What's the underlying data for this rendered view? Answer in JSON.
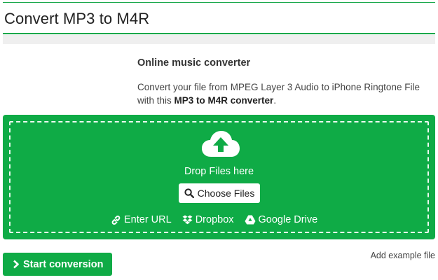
{
  "header": {
    "title": "Convert MP3 to M4R"
  },
  "intro": {
    "heading": "Online music converter",
    "text_before": "Convert your file from MPEG Layer 3 Audio to iPhone Ringtone File with this ",
    "text_bold": "MP3 to M4R converter",
    "text_after": "."
  },
  "upload": {
    "cloud_icon": "cloud-upload-icon",
    "drop_label": "Drop Files here",
    "choose_label": "Choose Files",
    "sources": [
      {
        "label": "Enter URL",
        "icon": "link-icon"
      },
      {
        "label": "Dropbox",
        "icon": "dropbox-icon"
      },
      {
        "label": "Google Drive",
        "icon": "google-drive-icon"
      }
    ]
  },
  "actions": {
    "start_label": "Start conversion",
    "example_label": "Add example file"
  },
  "colors": {
    "accent": "#0fab46",
    "rule": "#19a84b",
    "band": "#efefef"
  }
}
